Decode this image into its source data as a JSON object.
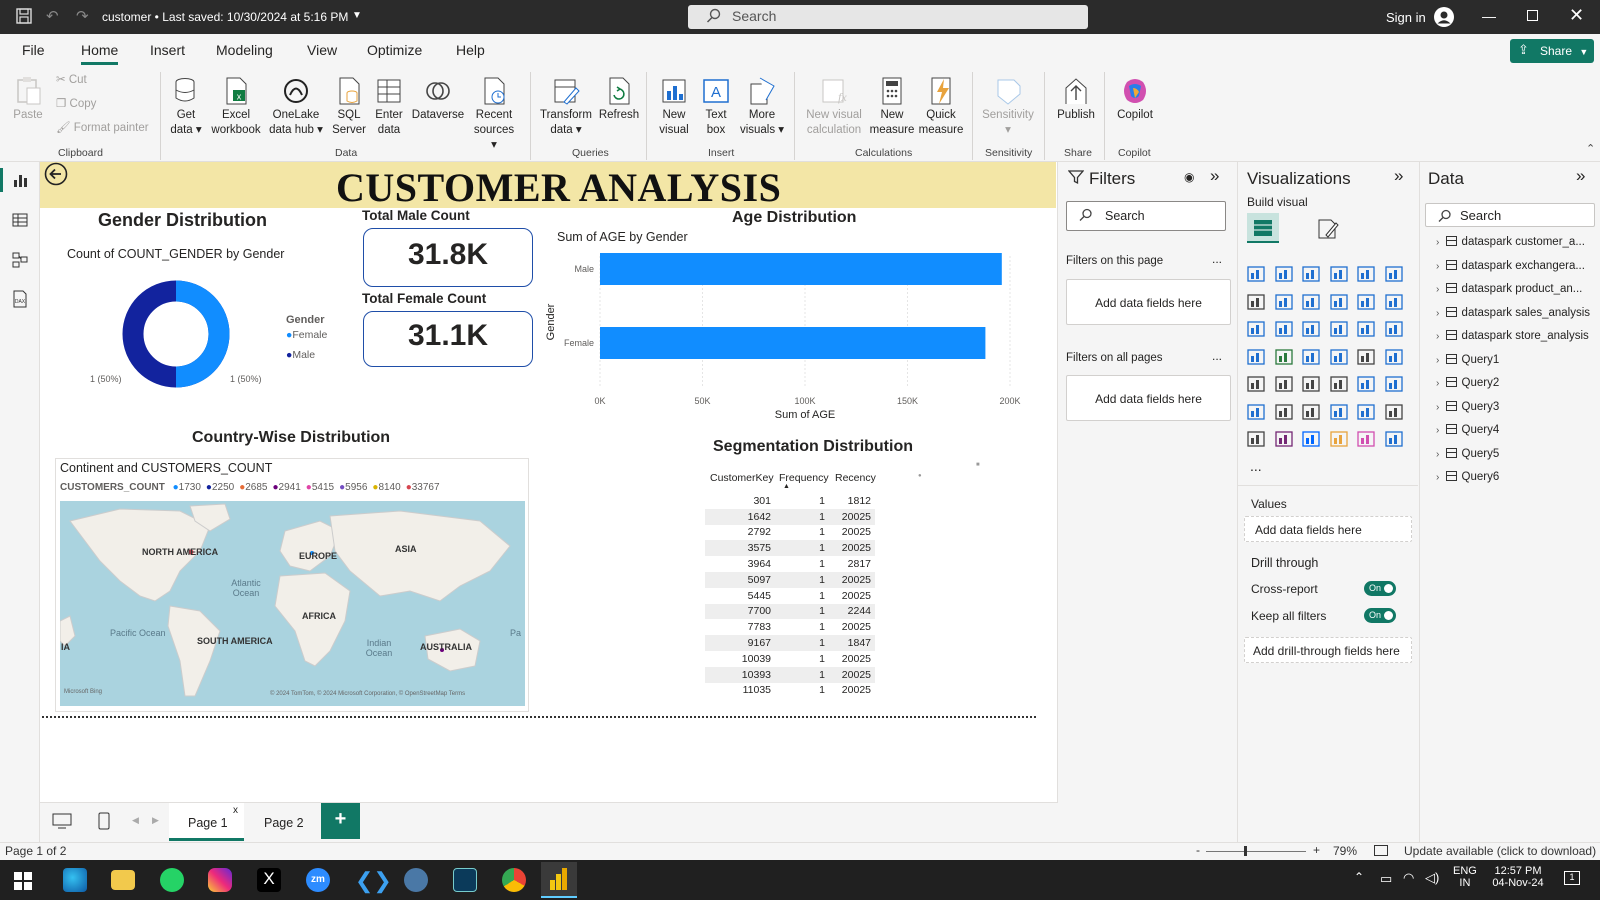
{
  "titlebar": {
    "doc": "customer • Last saved: 10/30/2024 at 5:16 PM",
    "search": "Search",
    "signin": "Sign in"
  },
  "ribbon_tabs": [
    "File",
    "Home",
    "Insert",
    "Modeling",
    "View",
    "Optimize",
    "Help"
  ],
  "share": "Share",
  "ribbon": {
    "clipboard": {
      "paste": "Paste",
      "cut": "Cut",
      "copy": "Copy",
      "format_painter": "Format painter",
      "group": "Clipboard"
    },
    "data": {
      "get_data": "Get data",
      "excel": "Excel workbook",
      "onelake": "OneLake data hub",
      "sql": "SQL Server",
      "enter": "Enter data",
      "dataverse": "Dataverse",
      "recent": "Recent sources",
      "group": "Data"
    },
    "queries": {
      "transform": "Transform data",
      "refresh": "Refresh",
      "group": "Queries"
    },
    "insert": {
      "new_visual": "New visual",
      "text_box": "Text box",
      "more_visuals": "More visuals",
      "group": "Insert"
    },
    "calculations": {
      "new_visual_calc": "New visual calculation",
      "new_measure": "New measure",
      "quick_measure": "Quick measure",
      "group": "Calculations"
    },
    "sensitivity": {
      "label": "Sensitivity",
      "group": "Sensitivity"
    },
    "share": {
      "publish": "Publish",
      "group": "Share"
    },
    "copilot": {
      "label": "Copilot",
      "group": "Copilot"
    }
  },
  "report": {
    "banner": "CUSTOMER ANALYSIS",
    "gender": {
      "title": "Gender Distribution",
      "subtitle": "Count of COUNT_GENDER by Gender",
      "legend_title": "Gender",
      "legend": [
        "Female",
        "Male"
      ],
      "label_left": "1 (50%)",
      "label_right": "1 (50%)",
      "colors": {
        "female": "#118dff",
        "male": "#12239e"
      }
    },
    "male_card": {
      "label": "Total Male Count",
      "value": "31.8K"
    },
    "female_card": {
      "label": "Total Female Count",
      "value": "31.1K"
    },
    "age": {
      "title": "Age Distribution",
      "subtitle": "Sum of AGE by Gender"
    },
    "country": {
      "title": "Country-Wise Distribution",
      "subtitle": "Continent and CUSTOMERS_COUNT",
      "legend_label": "CUSTOMERS_COUNT",
      "legend": [
        {
          "v": "1730",
          "c": "#118dff"
        },
        {
          "v": "2250",
          "c": "#12239e"
        },
        {
          "v": "2685",
          "c": "#e66c37"
        },
        {
          "v": "2941",
          "c": "#6b007b"
        },
        {
          "v": "5415",
          "c": "#e044a7"
        },
        {
          "v": "5956",
          "c": "#744ec2"
        },
        {
          "v": "8140",
          "c": "#d9b300"
        },
        {
          "v": "33767",
          "c": "#d64550"
        }
      ],
      "labels": {
        "na": "NORTH AMERICA",
        "eu": "EUROPE",
        "asia": "ASIA",
        "atl": "Atlantic Ocean",
        "africa": "AFRICA",
        "pac": "Pacific Ocean",
        "sa": "SOUTH AMERICA",
        "ind": "Indian Ocean",
        "aus": "AUSTRALIA",
        "ia": "IA",
        "pa": "Pa"
      },
      "attribution": "© 2024 TomTom, © 2024 Microsoft Corporation, © OpenStreetMap Terms",
      "bing": "Microsoft Bing"
    },
    "seg": {
      "title": "Segmentation Distribution",
      "headers": [
        "CustomerKey",
        "Frequency",
        "Recency"
      ],
      "rows": [
        [
          "301",
          "1",
          "1812"
        ],
        [
          "1642",
          "1",
          "20025"
        ],
        [
          "2792",
          "1",
          "20025"
        ],
        [
          "3575",
          "1",
          "20025"
        ],
        [
          "3964",
          "1",
          "2817"
        ],
        [
          "5097",
          "1",
          "20025"
        ],
        [
          "5445",
          "1",
          "20025"
        ],
        [
          "7700",
          "1",
          "2244"
        ],
        [
          "7783",
          "1",
          "20025"
        ],
        [
          "9167",
          "1",
          "1847"
        ],
        [
          "10039",
          "1",
          "20025"
        ],
        [
          "10393",
          "1",
          "20025"
        ],
        [
          "11035",
          "1",
          "20025"
        ]
      ]
    }
  },
  "chart_data": {
    "type": "bar",
    "title": "Age Distribution",
    "subtitle": "Sum of AGE by Gender",
    "categories": [
      "Male",
      "Female"
    ],
    "values": [
      196000,
      188000
    ],
    "xlabel": "Sum of AGE",
    "ylabel": "Gender",
    "xlim": [
      0,
      200000
    ],
    "ticks": [
      "0K",
      "50K",
      "100K",
      "150K",
      "200K"
    ],
    "color": "#118dff"
  },
  "pages": {
    "p1": "Page 1",
    "p1_close": "x",
    "p2": "Page 2",
    "add": "+"
  },
  "status": {
    "page": "Page 1 of 2",
    "zoom": "79%",
    "update": "Update available (click to download)",
    "minus": "-",
    "plus": "+"
  },
  "filters": {
    "title": "Filters",
    "search": "Search",
    "on_page": "Filters on this page",
    "on_all": "Filters on all pages",
    "add": "Add data fields here",
    "dots": "..."
  },
  "viz": {
    "title": "Visualizations",
    "build": "Build visual",
    "values": "Values",
    "add": "Add data fields here",
    "drill": "Drill through",
    "cross": "Cross-report",
    "keep": "Keep all filters",
    "on": "On",
    "drill_add": "Add drill-through fields here",
    "more": "..."
  },
  "data": {
    "title": "Data",
    "search": "Search",
    "items": [
      "dataspark customer_a...",
      "dataspark exchangera...",
      "dataspark product_an...",
      "dataspark sales_analysis",
      "dataspark store_analysis",
      "Query1",
      "Query2",
      "Query3",
      "Query4",
      "Query5",
      "Query6"
    ]
  },
  "taskbar": {
    "lang1": "ENG",
    "lang2": "IN",
    "time": "12:57 PM",
    "date": "04-Nov-24",
    "notif": "1"
  }
}
